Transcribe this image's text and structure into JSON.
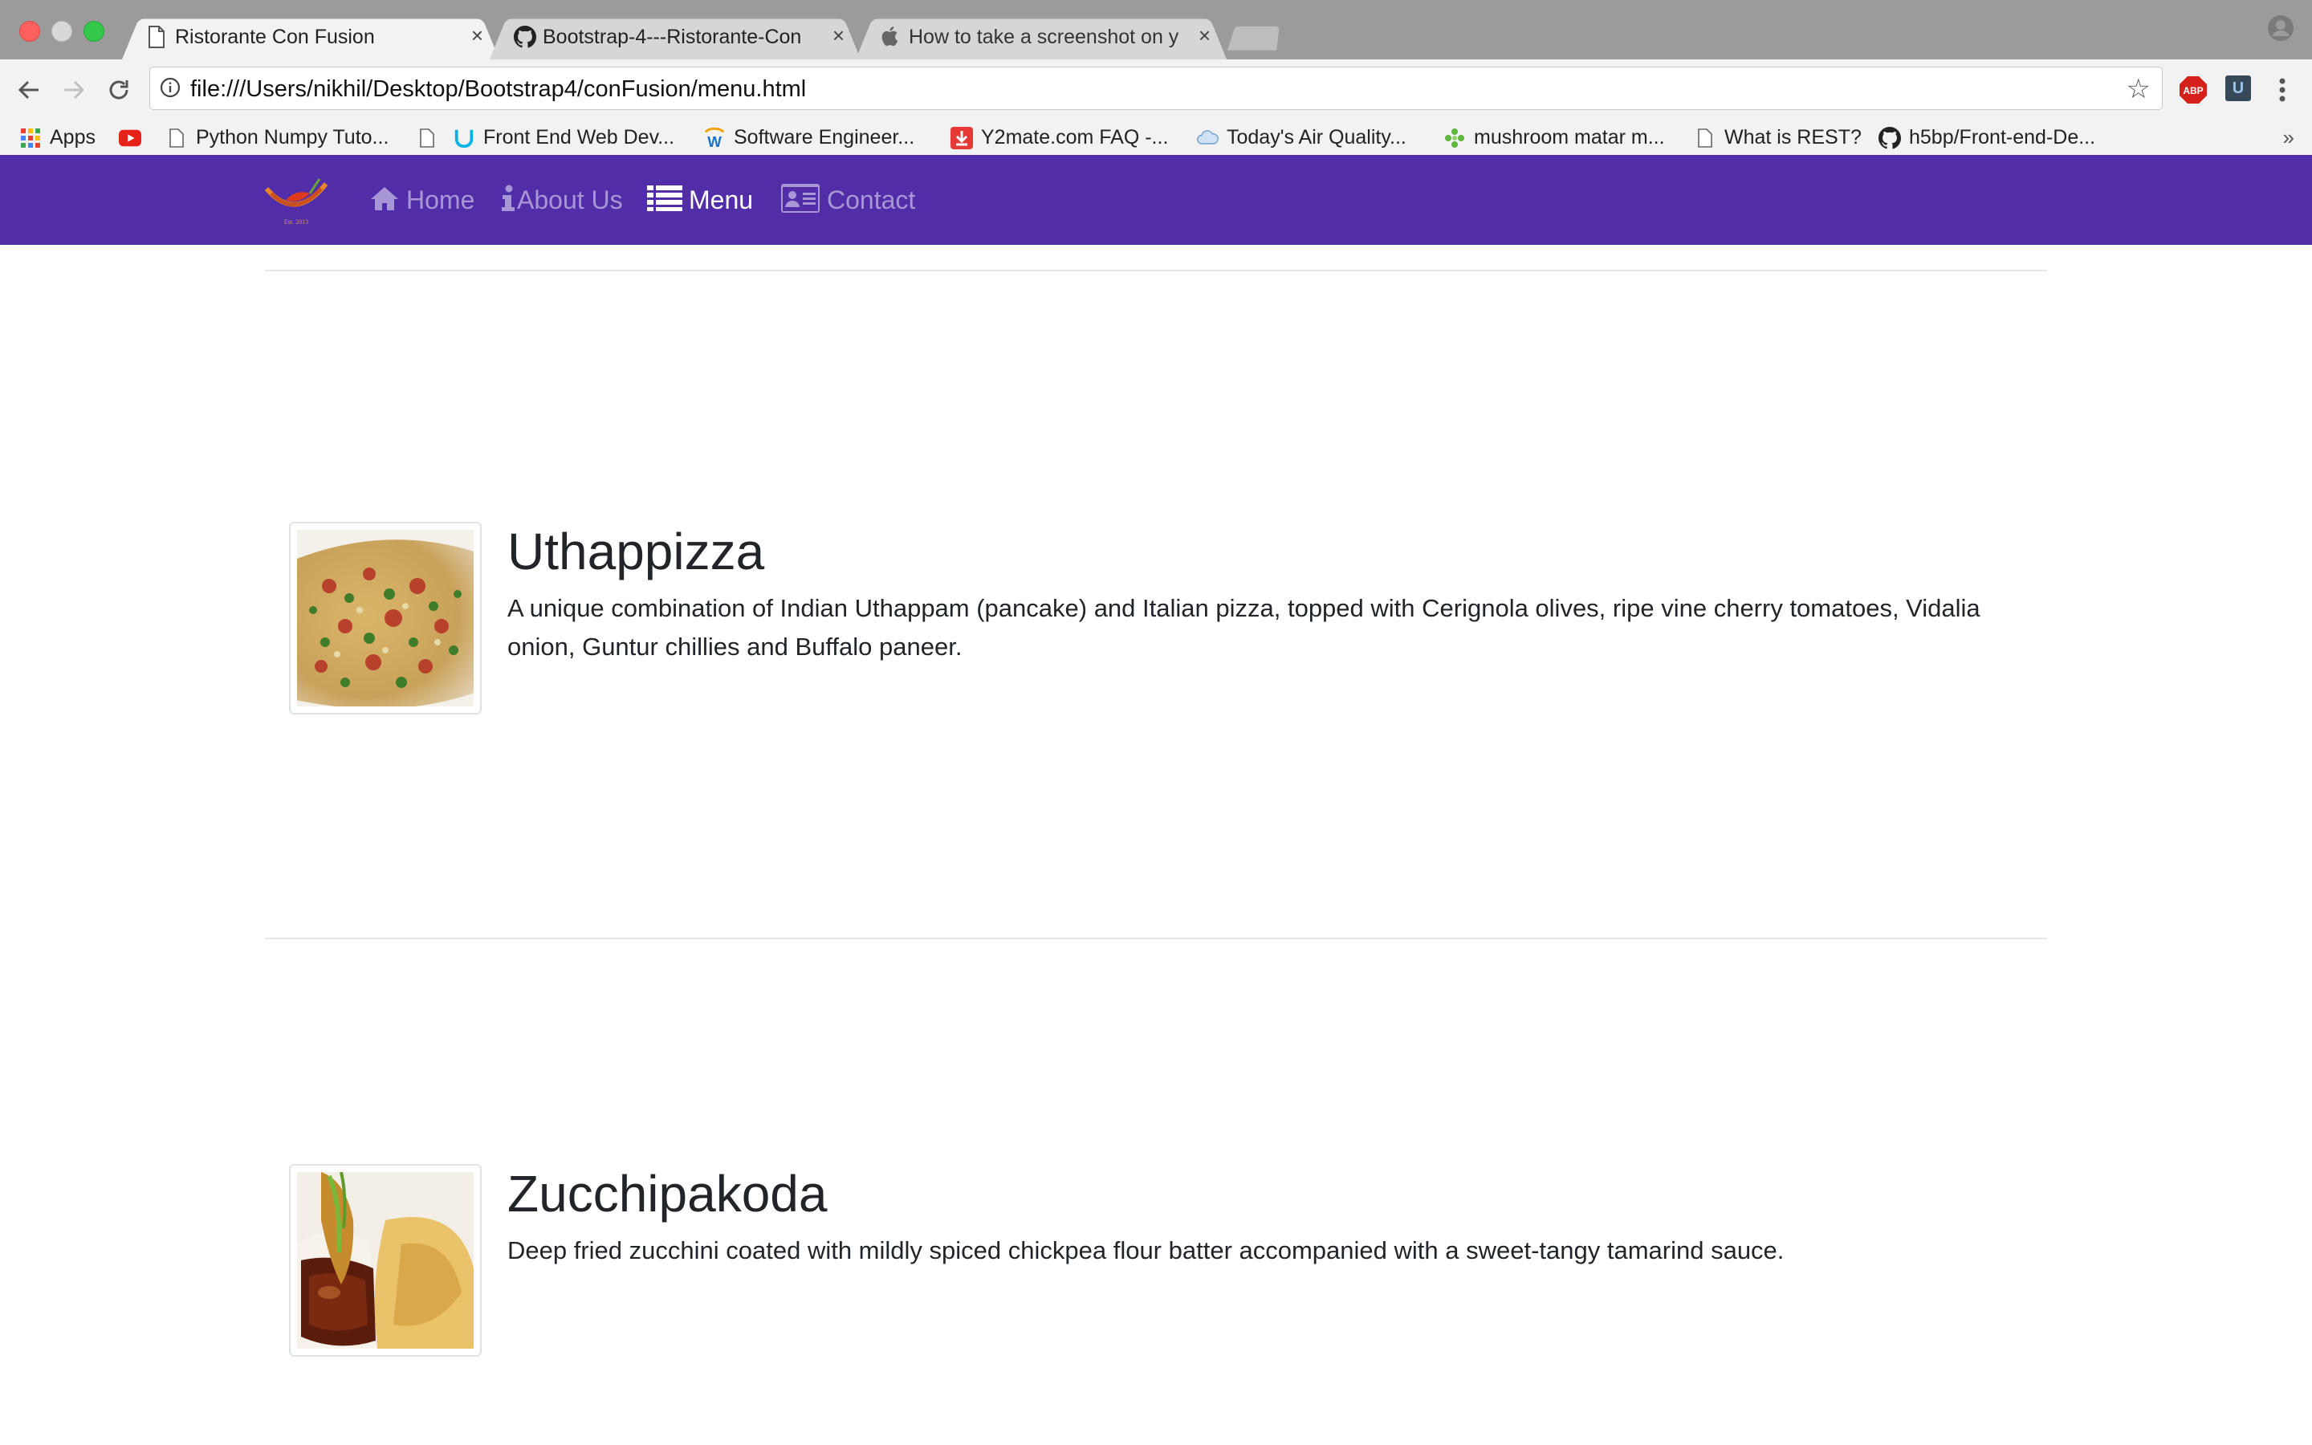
{
  "browser": {
    "tabs": [
      {
        "title": "Ristorante Con Fusion",
        "icon": "page-icon",
        "active": true
      },
      {
        "title": "Bootstrap-4---Ristorante-Con",
        "icon": "github-icon",
        "active": false
      },
      {
        "title": "How to take a screenshot on y",
        "icon": "apple-icon",
        "active": false
      }
    ],
    "tab_close_glyph": "×",
    "url": "file:///Users/nikhil/Desktop/Bootstrap4/conFusion/menu.html",
    "bookmarks": [
      {
        "label": "Apps",
        "icon": "apps-grid-icon"
      },
      {
        "label": "",
        "icon": "youtube-icon"
      },
      {
        "label": "Python Numpy Tuto...",
        "icon": "page-icon"
      },
      {
        "label": "",
        "icon": "page-icon"
      },
      {
        "label": "Front End Web Dev...",
        "icon": "udacity-icon"
      },
      {
        "label": "Software Engineer...",
        "icon": "w-logo-icon"
      },
      {
        "label": "Y2mate.com FAQ -...",
        "icon": "download-icon"
      },
      {
        "label": "Today's Air Quality...",
        "icon": "cloud-icon"
      },
      {
        "label": "mushroom matar m...",
        "icon": "leaf-icon"
      },
      {
        "label": "What is REST?",
        "icon": "page-icon"
      },
      {
        "label": "h5bp/Front-end-De...",
        "icon": "github-icon"
      }
    ],
    "bookmarks_overflow": "»",
    "extensions": {
      "abp_label": "ABP",
      "ext2_label": "U"
    },
    "colors": {
      "tabstrip": "#9b9b9b",
      "toolbar": "#f2f2f2"
    }
  },
  "site": {
    "colors": {
      "navbar": "#512da8",
      "nav_inactive": "#a797d6",
      "nav_active": "#ffffff"
    },
    "logo_caption": "Est. 2013",
    "nav": [
      {
        "label": "Home",
        "icon": "home-icon",
        "active": false
      },
      {
        "label": "About Us",
        "icon": "info-icon",
        "active": false
      },
      {
        "label": "Menu",
        "icon": "list-icon",
        "active": true
      },
      {
        "label": "Contact",
        "icon": "address-card-icon",
        "active": false
      }
    ]
  },
  "menu": {
    "items": [
      {
        "name": "Uthappizza",
        "description": "A unique combination of Indian Uthappam (pancake) and Italian pizza, topped with Cerignola olives, ripe vine cherry tomatoes, Vidalia onion, Guntur chillies and Buffalo paneer.",
        "image": "pizza-image"
      },
      {
        "name": "Zucchipakoda",
        "description": "Deep fried zucchini coated with mildly spiced chickpea flour batter accompanied with a sweet-tangy tamarind sauce.",
        "image": "zucchini-fritter-image"
      }
    ]
  }
}
